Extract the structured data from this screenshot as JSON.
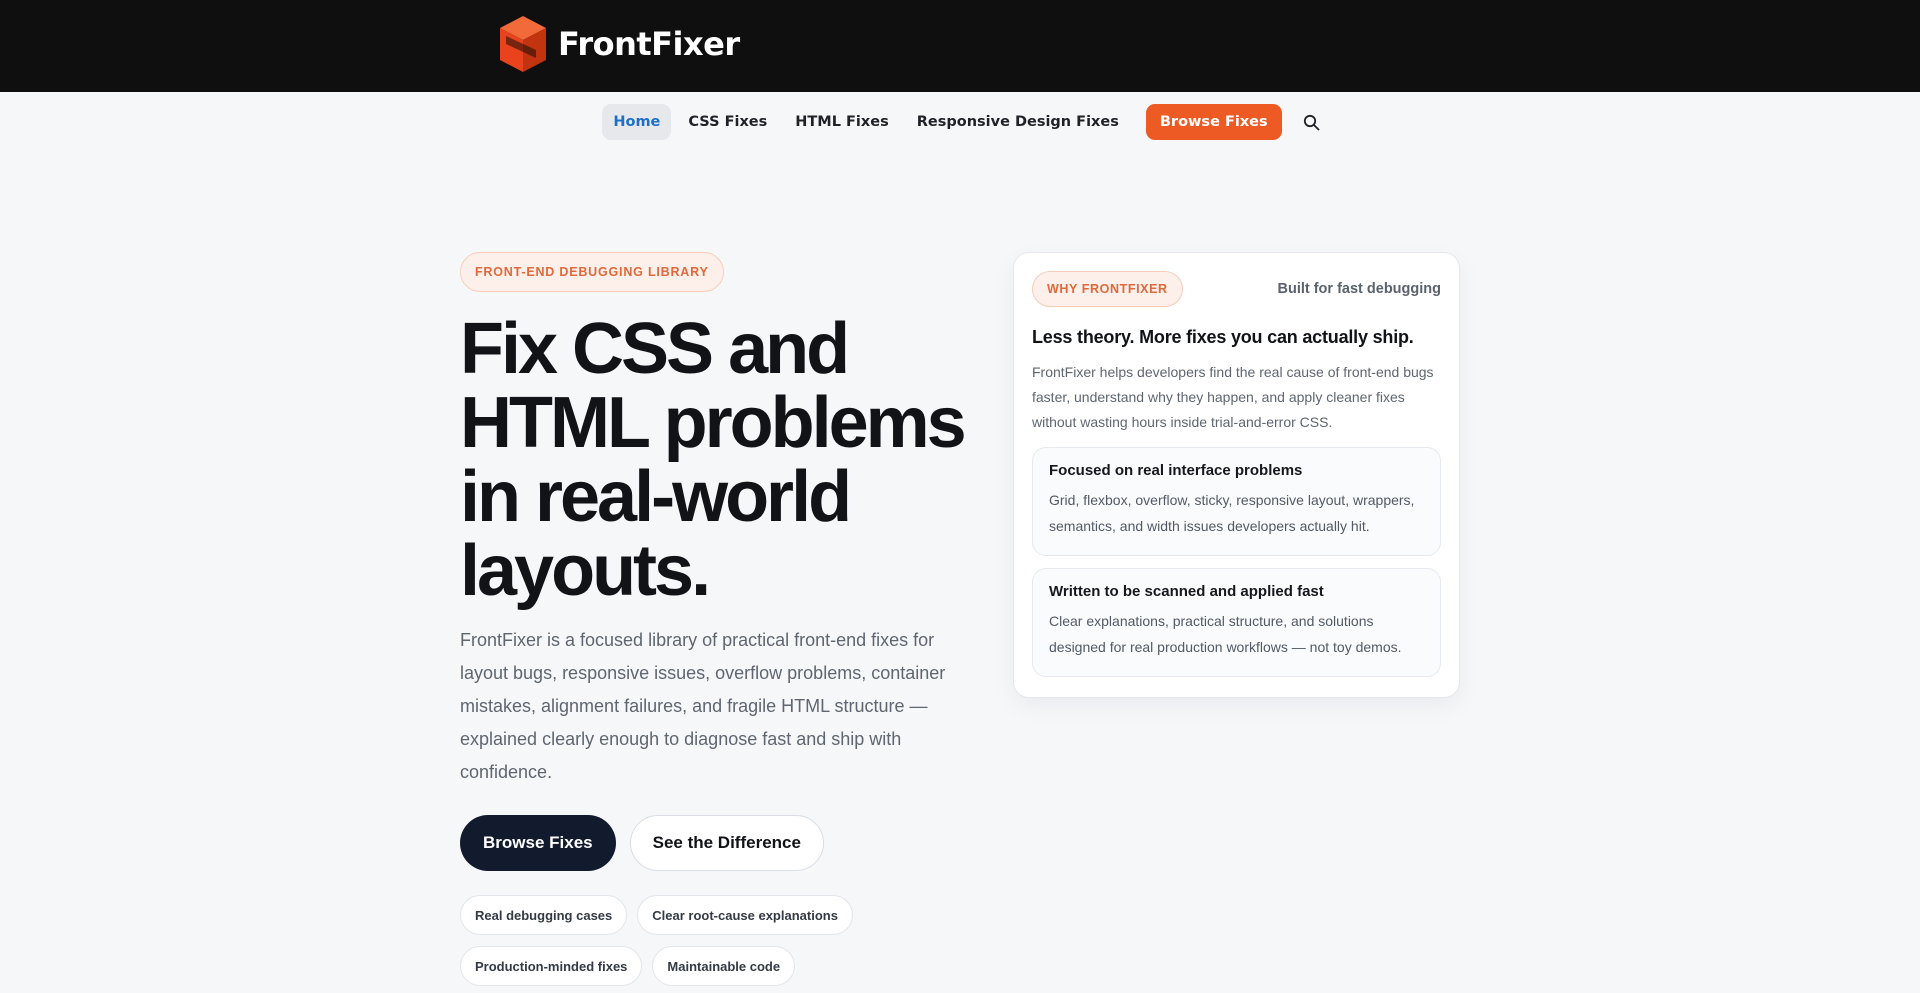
{
  "brand": {
    "name": "FrontFixer",
    "logo_icon": "cube-logo-icon",
    "accent_color": "#ee5a24",
    "dark_color": "#121a2e"
  },
  "nav": {
    "items": [
      {
        "label": "Home",
        "active": true
      },
      {
        "label": "CSS Fixes",
        "active": false
      },
      {
        "label": "HTML Fixes",
        "active": false
      },
      {
        "label": "Responsive Design Fixes",
        "active": false
      }
    ],
    "cta_label": "Browse Fixes",
    "search_icon": "search-icon"
  },
  "hero": {
    "eyebrow": "FRONT-END DEBUGGING LIBRARY",
    "headline": "Fix CSS and HTML problems in real-world layouts.",
    "lead": "FrontFixer is a focused library of practical front-end fixes for layout bugs, responsive issues, overflow problems, container mistakes, alignment failures, and fragile HTML structure — explained clearly enough to diagnose fast and ship with confidence.",
    "primary_button": "Browse Fixes",
    "secondary_button": "See the Difference",
    "chips": [
      "Real debugging cases",
      "Clear root-cause explanations",
      "Production-minded fixes",
      "Maintainable code"
    ]
  },
  "card": {
    "badge": "WHY FRONTFIXER",
    "note": "Built for fast debugging",
    "title": "Less theory. More fixes you can actually ship.",
    "text": "FrontFixer helps developers find the real cause of front-end bugs faster, understand why they happen, and apply cleaner fixes without wasting hours inside trial-and-error CSS.",
    "features": [
      {
        "title": "Focused on real interface problems",
        "text": "Grid, flexbox, overflow, sticky, responsive layout, wrappers, semantics, and width issues developers actually hit."
      },
      {
        "title": "Written to be scanned and applied fast",
        "text": "Clear explanations, practical structure, and solutions designed for real production workflows — not toy demos."
      }
    ]
  }
}
